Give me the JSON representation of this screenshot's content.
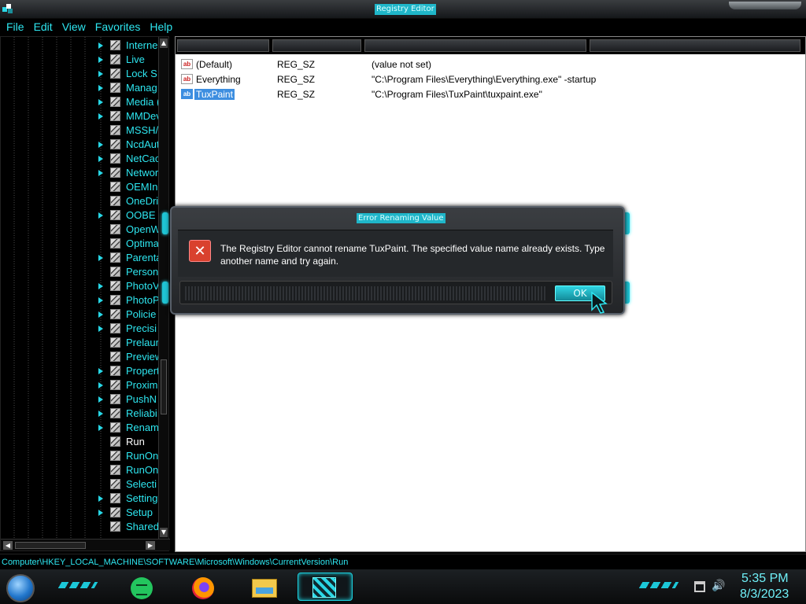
{
  "window": {
    "title": "Registry Editor",
    "app_icon": "regedit-icon"
  },
  "menu": [
    "File",
    "Edit",
    "View",
    "Favorites",
    "Help"
  ],
  "tree": {
    "items": [
      {
        "label": "Interne",
        "expandable": true
      },
      {
        "label": "Live",
        "expandable": true
      },
      {
        "label": "Lock S",
        "expandable": true
      },
      {
        "label": "Manag",
        "expandable": true
      },
      {
        "label": "Media (",
        "expandable": true
      },
      {
        "label": "MMDev",
        "expandable": true
      },
      {
        "label": "MSSH/",
        "expandable": false
      },
      {
        "label": "NcdAut",
        "expandable": true
      },
      {
        "label": "NetCac",
        "expandable": true
      },
      {
        "label": "Networ",
        "expandable": true
      },
      {
        "label": "OEMIn",
        "expandable": false
      },
      {
        "label": "OneDri",
        "expandable": false
      },
      {
        "label": "OOBE",
        "expandable": true
      },
      {
        "label": "OpenW",
        "expandable": false
      },
      {
        "label": "Optima",
        "expandable": false
      },
      {
        "label": "Parenta",
        "expandable": true
      },
      {
        "label": "Person",
        "expandable": false
      },
      {
        "label": "PhotoV",
        "expandable": true
      },
      {
        "label": "PhotoP",
        "expandable": true
      },
      {
        "label": "Policie",
        "expandable": true
      },
      {
        "label": "Precisi",
        "expandable": true
      },
      {
        "label": "Prelaur",
        "expandable": false
      },
      {
        "label": "Preview",
        "expandable": false
      },
      {
        "label": "Propert",
        "expandable": true
      },
      {
        "label": "Proxim",
        "expandable": true
      },
      {
        "label": "PushN",
        "expandable": true
      },
      {
        "label": "Reliabi",
        "expandable": true
      },
      {
        "label": "Renam",
        "expandable": true
      },
      {
        "label": "Run",
        "expandable": false,
        "selected": true
      },
      {
        "label": "RunOn",
        "expandable": false
      },
      {
        "label": "RunOn",
        "expandable": false
      },
      {
        "label": "Selecti",
        "expandable": false
      },
      {
        "label": "Setting",
        "expandable": true
      },
      {
        "label": "Setup",
        "expandable": true
      },
      {
        "label": "Shared",
        "expandable": false
      }
    ]
  },
  "values": [
    {
      "name": "(Default)",
      "type": "REG_SZ",
      "data": "(value not set)",
      "selected": false
    },
    {
      "name": "Everything",
      "type": "REG_SZ",
      "data": "\"C:\\Program Files\\Everything\\Everything.exe\" -startup",
      "selected": false
    },
    {
      "name": "TuxPaint",
      "type": "REG_SZ",
      "data": "\"C:\\Program Files\\TuxPaint\\tuxpaint.exe\"",
      "selected": true
    }
  ],
  "dialog": {
    "title": "Error Renaming Value",
    "message": "The Registry Editor cannot rename TuxPaint. The specified value name already exists. Type another name and try again.",
    "ok_label": "OK",
    "icon": "error-x-icon"
  },
  "status": {
    "path": "Computer\\HKEY_LOCAL_MACHINE\\SOFTWARE\\Microsoft\\Windows\\CurrentVersion\\Run"
  },
  "taskbar": {
    "apps": [
      "notes-icon",
      "firefox-icon",
      "file-explorer-icon",
      "regedit-icon"
    ],
    "time": "5:35 PM",
    "date": "8/3/2023"
  },
  "colors": {
    "accent": "#2ee6f0",
    "selection": "#3d8ee0",
    "error": "#d9412e"
  }
}
